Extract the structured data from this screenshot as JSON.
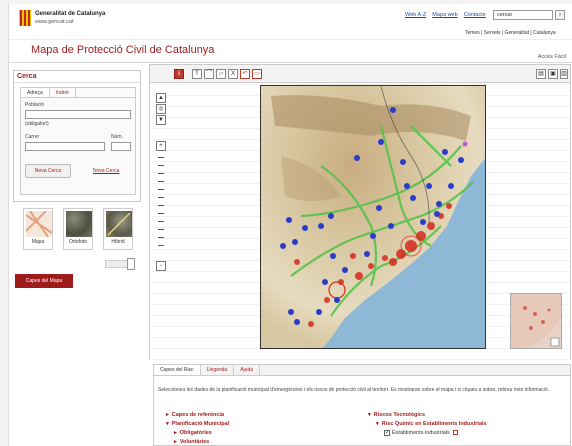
{
  "header": {
    "org_name": "Generalitat de Catalunya",
    "org_url": "www.gencat.cat",
    "links": [
      "Web A-Z",
      "Mapa web",
      "Contacte"
    ],
    "search_value": "cercar",
    "search_button": "›",
    "sublinks": "Temes | Serveis | Generalitat | Catalunya"
  },
  "page": {
    "title": "Mapa de Protecció Civil de Catalunya",
    "acces": "Accés Fàcil"
  },
  "search_panel": {
    "title": "Cerca",
    "tabs": [
      "Adreça",
      "Indret"
    ],
    "poblacio_label": "Població",
    "poblacio_hint": "(obligatori)",
    "carrer_label": "Carrer",
    "num_label": "Núm.",
    "new_search_button": "Nova Cerca",
    "new_search_link": "Nova Cerca"
  },
  "basemaps": [
    "Mapa",
    "Ortofoto",
    "Híbrid"
  ],
  "layers_button": "Capes del Mapa",
  "toolbar": {
    "info": "i",
    "text": "T",
    "measure": "⌒",
    "area": "▱",
    "clear": "X",
    "undo": "↶",
    "tool6": "▭",
    "print": "▤",
    "print2": "▣",
    "pdf": "▥"
  },
  "nav": {
    "pan_up": "▲",
    "pan_mid": "◎",
    "pan_down": "▼",
    "zoom_in": "+",
    "zoom_out": "−"
  },
  "bottom": {
    "tabs": [
      "Capes del Risc",
      "Llegenda",
      "Ajuda"
    ],
    "intro": "Seleccioneu les dades de la planificació municipal d'emergències i els riscos de protecció civil al territori. Es mostraran sobre el mapa i si clqueu a sobre, rebreu més informació.",
    "left_tree": [
      "Capes de referència",
      "Planificació Municipal",
      "Obligatòries",
      "Voluntàries"
    ],
    "right_tree": [
      "Riscos Tecnològics",
      "Risc Químic en Establiments Industrials",
      "Establiments industrials"
    ]
  },
  "colors": {
    "brand_red": "#9e1b1b",
    "marker_blue": "#2b3cc8",
    "marker_red": "#d42a1e",
    "road_green": "#55c24a"
  }
}
